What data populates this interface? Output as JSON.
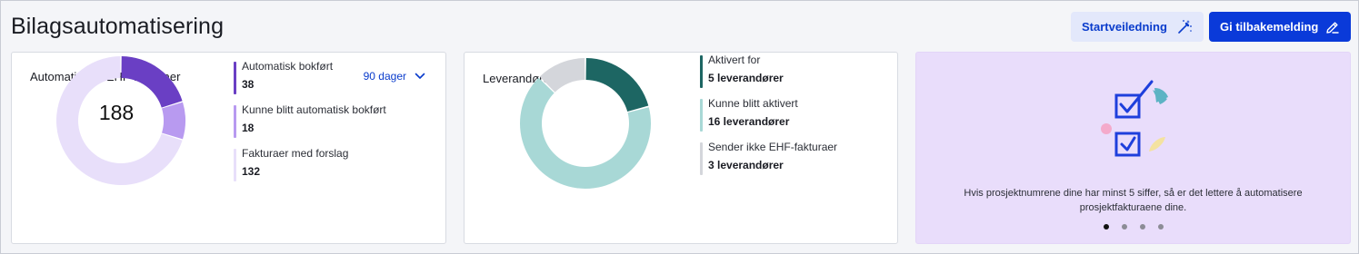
{
  "header": {
    "title": "Bilagsautomatisering",
    "guide_label": "Startveiledning",
    "feedback_label": "Gi tilbakemelding"
  },
  "ehf_card": {
    "title": "Automatiserte EHF-fakturaer",
    "period": "90 dager",
    "total": "188",
    "legend": [
      {
        "label": "Automatisk bokført",
        "value": "38",
        "color": "#6a3fc4"
      },
      {
        "label": "Kunne blitt automatisk bokført",
        "value": "18",
        "color": "#b89af0"
      },
      {
        "label": "Fakturaer med forslag",
        "value": "132",
        "color": "#e8dffa"
      }
    ]
  },
  "supplier_card": {
    "title": "Leverandører",
    "legend": [
      {
        "label": "Aktivert for",
        "value": "5 leverandører",
        "color": "#1d6663"
      },
      {
        "label": "Kunne blitt aktivert",
        "value": "16 leverandører",
        "color": "#a8d8d6"
      },
      {
        "label": "Sender ikke EHF-fakturaer",
        "value": "3 leverandører",
        "color": "#d4d6db"
      }
    ]
  },
  "chart_data": [
    {
      "type": "pie",
      "categories": [
        "Automatisk bokført",
        "Kunne blitt automatisk bokført",
        "Fakturaer med forslag"
      ],
      "values": [
        38,
        18,
        132
      ],
      "colors": [
        "#6a3fc4",
        "#b89af0",
        "#e8dffa"
      ]
    },
    {
      "type": "pie",
      "categories": [
        "Aktivert for",
        "Kunne blitt aktivert",
        "Sender ikke EHF-fakturaer"
      ],
      "values": [
        5,
        16,
        3
      ],
      "colors": [
        "#1d6663",
        "#a8d8d6",
        "#d4d6db"
      ]
    }
  ],
  "tip_card": {
    "text": "Hvis prosjektnumrene dine har minst 5 siffer, så er det lettere å automatisere prosjektfakturaene dine.",
    "slides": 4,
    "active_slide": 0
  }
}
